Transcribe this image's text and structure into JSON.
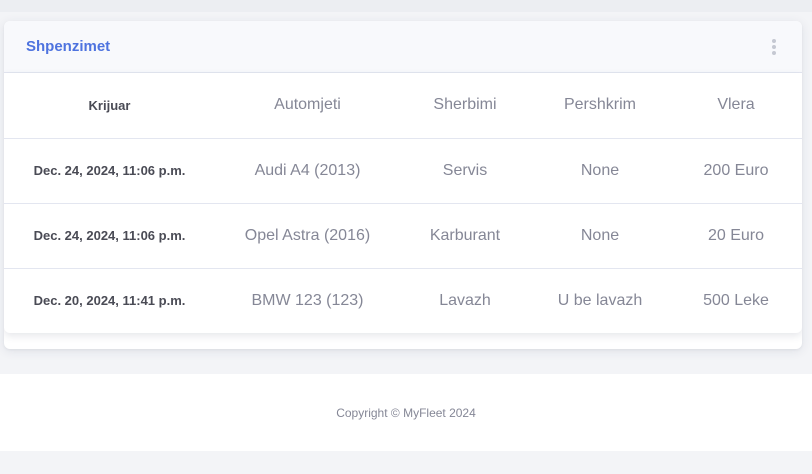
{
  "card": {
    "title": "Shpenzimet",
    "menu_icon": "vertical-ellipsis-icon"
  },
  "table": {
    "headers": [
      "Krijuar",
      "Automjeti",
      "Sherbimi",
      "Pershkrim",
      "Vlera"
    ],
    "rows": [
      [
        "Dec. 24, 2024, 11:06 p.m.",
        "Audi A4 (2013)",
        "Servis",
        "None",
        "200 Euro"
      ],
      [
        "Dec. 24, 2024, 11:06 p.m.",
        "Opel Astra (2016)",
        "Karburant",
        "None",
        "20 Euro"
      ],
      [
        "Dec. 20, 2024, 11:41 p.m.",
        "BMW 123 (123)",
        "Lavazh",
        "U be lavazh",
        "500 Leke"
      ]
    ]
  },
  "footer": {
    "copyright": "Copyright © MyFleet 2024"
  },
  "colors": {
    "accent": "#4e73df",
    "text_muted": "#858796",
    "text_dark": "#4a4b55"
  }
}
